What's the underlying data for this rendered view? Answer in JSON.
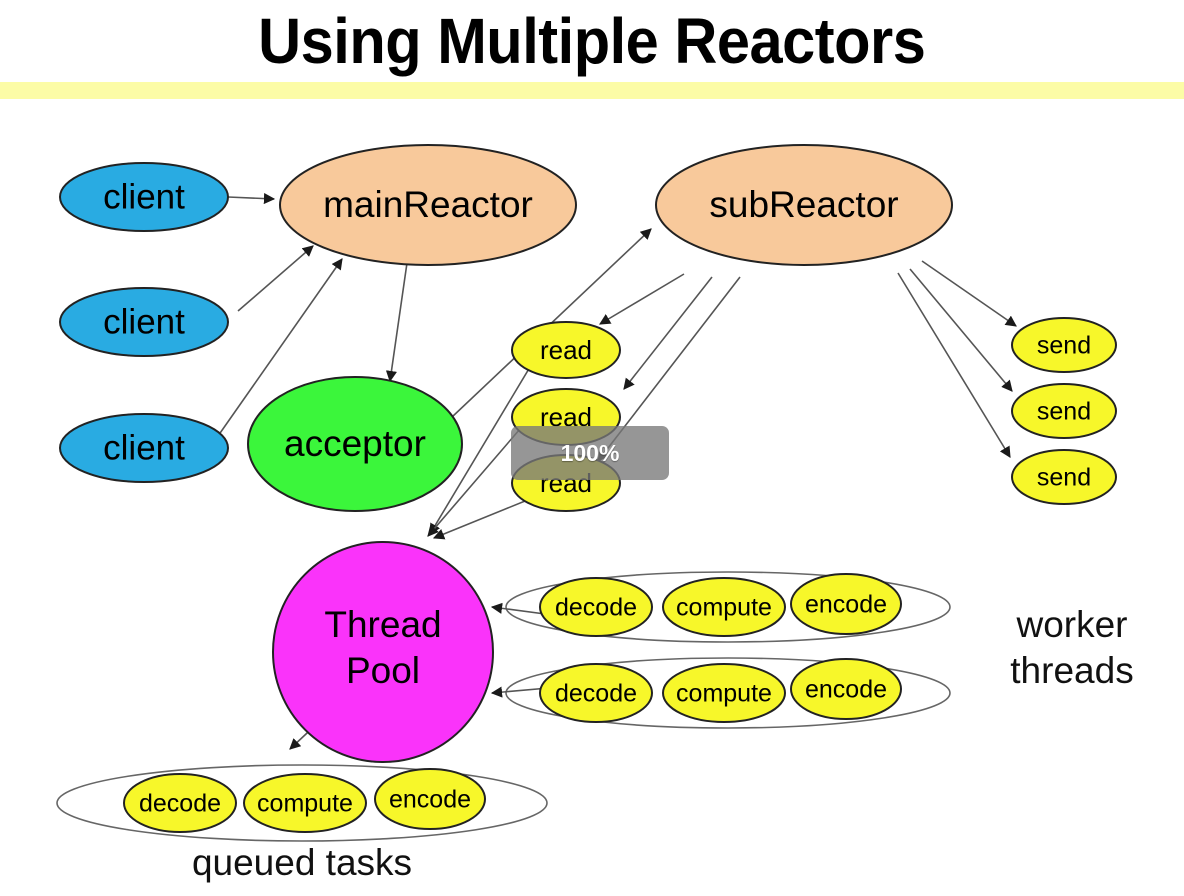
{
  "slide": {
    "title": "Using Multiple Reactors",
    "accent_band_color": "#fcfca6",
    "background_color": "#ffffff"
  },
  "palette": {
    "client_fill": "#29abe2",
    "reactor_fill": "#f8c99b",
    "acceptor_fill": "#3bf63b",
    "threadpool_fill": "#fa33fa",
    "task_fill": "#f7f72a",
    "node_stroke": "#222222",
    "edge_stroke": "#555555",
    "overlay_fill": "#787878",
    "overlay_text": "#ffffff"
  },
  "overlay": {
    "zoom_level": "100%"
  },
  "diagram": {
    "type": "node-link-diagram",
    "clients": [
      {
        "label": "client"
      },
      {
        "label": "client"
      },
      {
        "label": "client"
      }
    ],
    "reactors": [
      {
        "label": "mainReactor"
      },
      {
        "label": "subReactor"
      }
    ],
    "acceptor": {
      "label": "acceptor"
    },
    "thread_pool": {
      "label_line1": "Thread",
      "label_line2": "Pool"
    },
    "reads": [
      {
        "label": "read"
      },
      {
        "label": "read"
      },
      {
        "label": "read"
      }
    ],
    "sends": [
      {
        "label": "send"
      },
      {
        "label": "send"
      },
      {
        "label": "send"
      }
    ],
    "worker_threads": {
      "caption_line1": "worker",
      "caption_line2": "threads",
      "groups": [
        {
          "tasks": [
            {
              "label": "decode"
            },
            {
              "label": "compute"
            },
            {
              "label": "encode"
            }
          ]
        },
        {
          "tasks": [
            {
              "label": "decode"
            },
            {
              "label": "compute"
            },
            {
              "label": "encode"
            }
          ]
        }
      ]
    },
    "queued_tasks": {
      "caption": "queued tasks",
      "tasks": [
        {
          "label": "decode"
        },
        {
          "label": "compute"
        },
        {
          "label": "encode"
        }
      ]
    }
  }
}
